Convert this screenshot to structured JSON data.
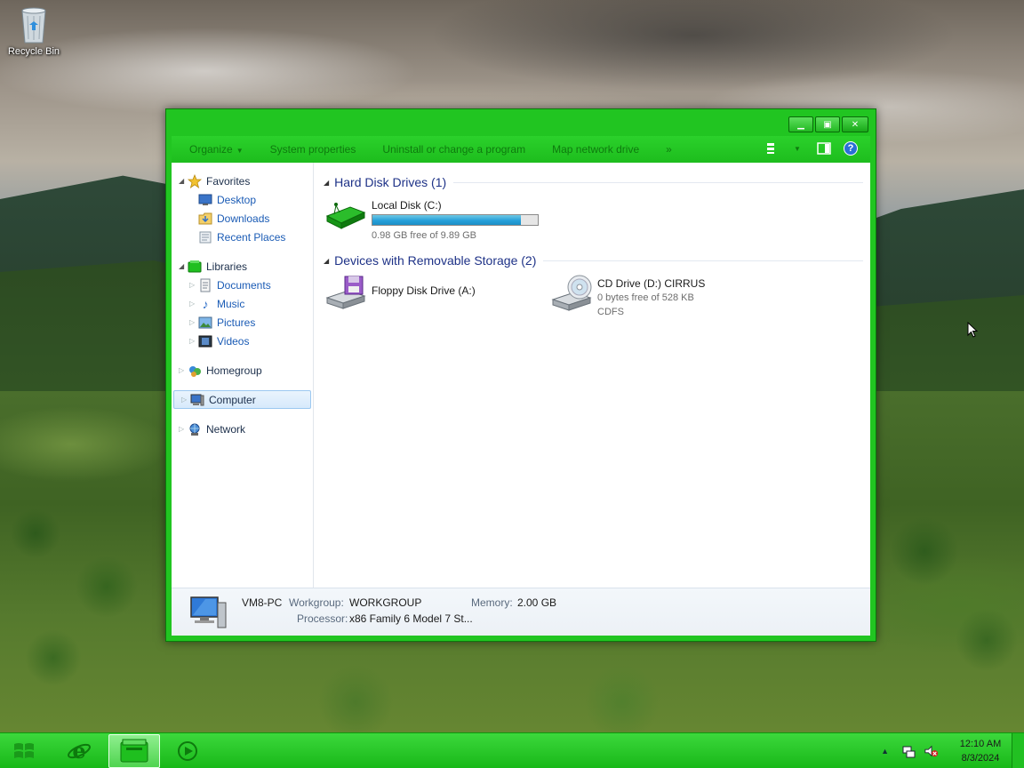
{
  "desktop": {
    "recycle_bin_label": "Recycle Bin"
  },
  "window": {
    "toolbar": {
      "organize": "Organize",
      "system_properties": "System properties",
      "uninstall": "Uninstall or change a program",
      "map_drive": "Map network drive",
      "more": "»"
    },
    "nav": {
      "favorites": {
        "label": "Favorites",
        "items": [
          "Desktop",
          "Downloads",
          "Recent Places"
        ]
      },
      "libraries": {
        "label": "Libraries",
        "items": [
          "Documents",
          "Music",
          "Pictures",
          "Videos"
        ]
      },
      "homegroup": "Homegroup",
      "computer": "Computer",
      "network": "Network"
    },
    "content": {
      "hard_disk_header": "Hard Disk Drives (1)",
      "removable_header": "Devices with Removable Storage (2)",
      "local_disk": {
        "name": "Local Disk (C:)",
        "free_text": "0.98 GB free of 9.89 GB",
        "used_fraction": 0.9
      },
      "floppy": {
        "name": "Floppy Disk Drive (A:)"
      },
      "cd_drive": {
        "name": "CD Drive (D:) CIRRUS",
        "free_text": "0 bytes free of 528 KB",
        "fs": "CDFS"
      }
    },
    "details": {
      "pc_name": "VM8-PC",
      "workgroup_label": "Workgroup:",
      "workgroup_value": "WORKGROUP",
      "memory_label": "Memory:",
      "memory_value": "2.00 GB",
      "processor_label": "Processor:",
      "processor_value": "x86 Family 6 Model 7 St..."
    }
  },
  "taskbar": {
    "clock_time": "12:10 AM",
    "clock_date": "8/3/2024"
  },
  "colors": {
    "window_frame": "#21c521",
    "taskbar": "#22c022",
    "progress_fill": "#26a0da",
    "link_blue": "#1a5bb5"
  }
}
